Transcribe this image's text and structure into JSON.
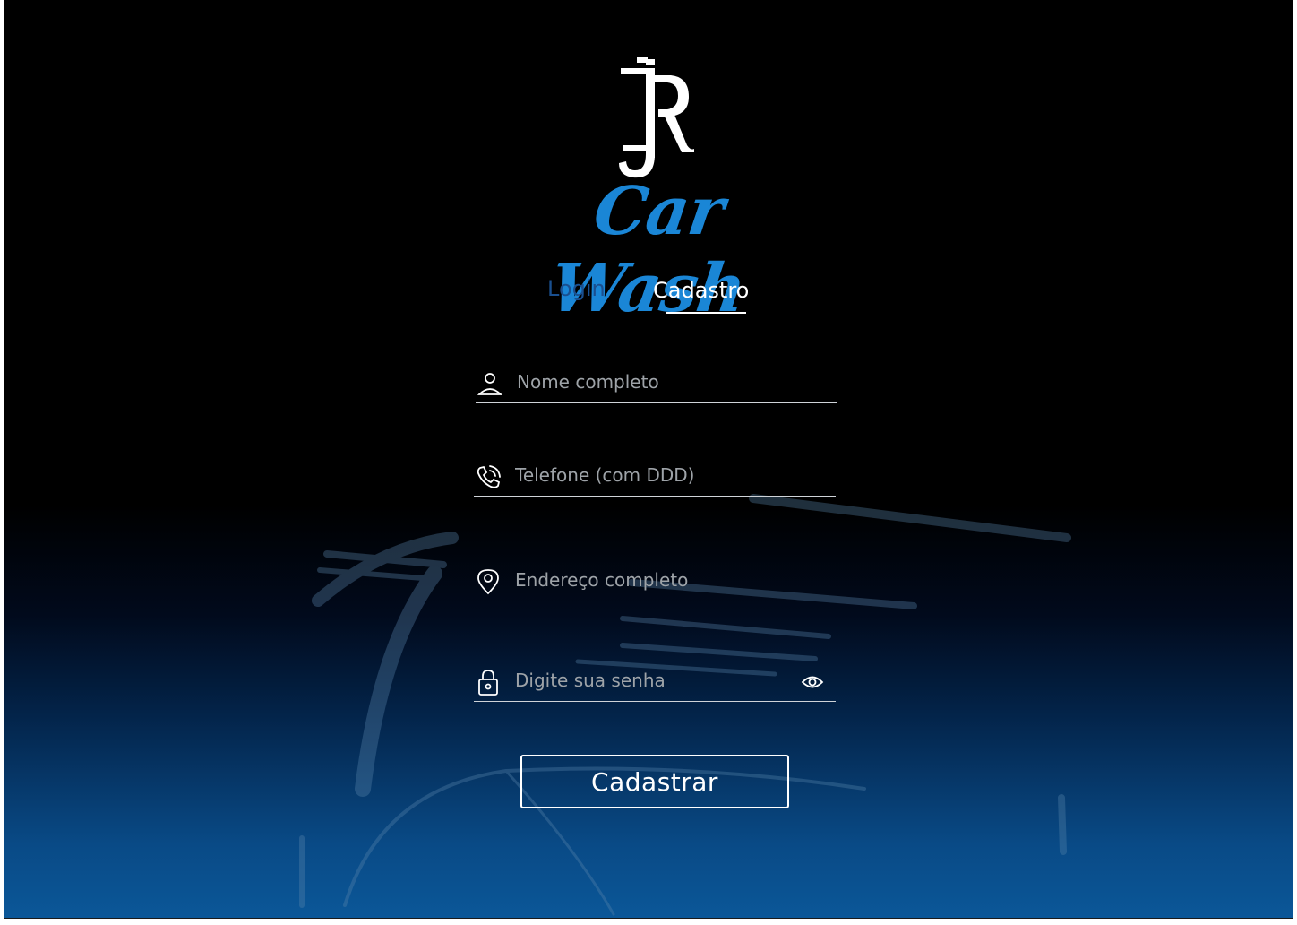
{
  "brand": {
    "monogram": "JR",
    "name": "Car Wash",
    "accent_color": "#1a86d6"
  },
  "tabs": {
    "login_label": "Login",
    "signup_label": "Cadastro",
    "active": "Cadastro"
  },
  "form": {
    "name_placeholder": "Nome completo",
    "phone_placeholder": "Telefone (com DDD)",
    "address_placeholder": "Endereço completo",
    "password_placeholder": "Digite sua senha",
    "submit_label": "Cadastrar"
  },
  "icons": {
    "name": "user-icon",
    "phone": "phone-icon",
    "address": "location-pin-icon",
    "password": "lock-icon",
    "toggle": "eye-icon"
  }
}
